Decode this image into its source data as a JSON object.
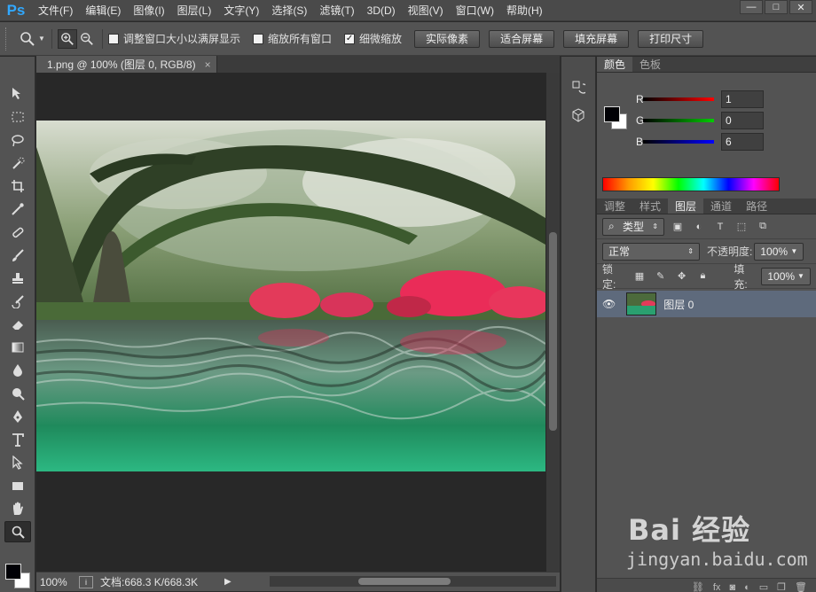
{
  "app": {
    "logo": "Ps"
  },
  "menu": [
    "文件(F)",
    "编辑(E)",
    "图像(I)",
    "图层(L)",
    "文字(Y)",
    "选择(S)",
    "滤镜(T)",
    "3D(D)",
    "视图(V)",
    "窗口(W)",
    "帮助(H)"
  ],
  "window_controls": {
    "minimize": "—",
    "maximize": "□",
    "close": "✕"
  },
  "options": {
    "checkboxes": [
      {
        "label": "调整窗口大小以满屏显示",
        "checked": false
      },
      {
        "label": "缩放所有窗口",
        "checked": false
      },
      {
        "label": "细微缩放",
        "checked": true
      }
    ],
    "buttons": [
      "实际像素",
      "适合屏幕",
      "填充屏幕",
      "打印尺寸"
    ]
  },
  "document": {
    "tab_title": "1.png @ 100% (图层 0, RGB/8)",
    "tab_close": "×"
  },
  "status": {
    "zoom": "100%",
    "doc_size": "文档:668.3 K/668.3K",
    "arrow": "▶"
  },
  "color_panel": {
    "tabs": [
      "颜色",
      "色板"
    ],
    "channels": [
      {
        "name": "R",
        "value": "1",
        "color": "#ff0000"
      },
      {
        "name": "G",
        "value": "0",
        "color": "#00cc00"
      },
      {
        "name": "B",
        "value": "6",
        "color": "#0000ff"
      }
    ],
    "foreground": "#010106",
    "background": "#ffffff"
  },
  "layers_panel": {
    "tabs": [
      "调整",
      "样式",
      "图层",
      "通道",
      "路径"
    ],
    "filter_label": "类型",
    "blend_mode": "正常",
    "opacity_label": "不透明度:",
    "opacity_value": "100%",
    "lock_label": "锁定:",
    "fill_label": "填充:",
    "fill_value": "100%",
    "layers": [
      {
        "name": "图层 0",
        "visible": true
      }
    ],
    "footer_fx": "fx"
  },
  "watermark": {
    "brand": "Bai 经验",
    "sub": "jingyan.baidu.com"
  }
}
